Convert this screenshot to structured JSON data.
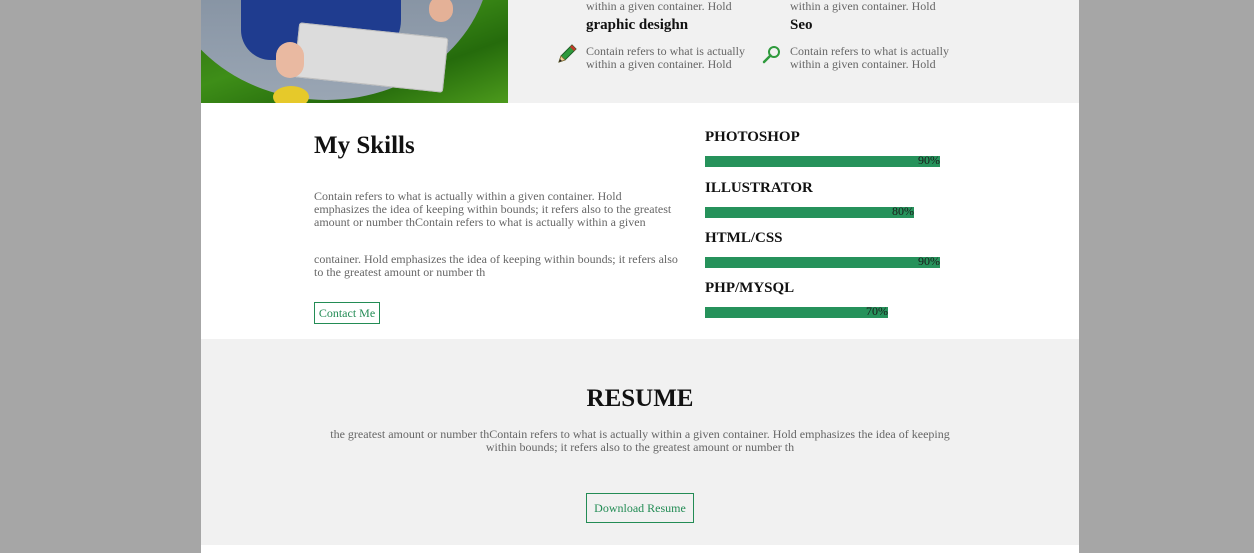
{
  "services": [
    {
      "top_text": "within a given container. Hold",
      "title": "graphic desighn",
      "icon": "pencil-icon",
      "text": "Contain refers to what is actually within a given container. Hold"
    },
    {
      "top_text": "within a given container. Hold",
      "title": "Seo",
      "icon": "magnifier-icon",
      "text": "Contain refers to what is actually within a given container. Hold"
    }
  ],
  "skills_section": {
    "title": "My Skills",
    "para1": "Contain refers to what is actually within a given container. Hold emphasizes the idea of keeping within bounds; it refers also to the greatest amount or number thContain refers to what is actually within a given",
    "para2": "container. Hold emphasizes the idea of keeping within bounds; it refers also to the greatest amount or number th",
    "contact_button": "Contact Me",
    "skills": [
      {
        "name": "PHOTOSHOP",
        "percent": 90,
        "label": "90%"
      },
      {
        "name": "ILLUSTRATOR",
        "percent": 80,
        "label": "80%"
      },
      {
        "name": "HTML/CSS",
        "percent": 90,
        "label": "90%"
      },
      {
        "name": "PHP/MYSQL",
        "percent": 70,
        "label": "70%"
      }
    ]
  },
  "resume": {
    "title": "RESUME",
    "text": "the greatest amount or number thContain refers to what is actually within a given container. Hold emphasizes the idea of keeping within bounds; it refers also to the greatest amount or number th",
    "download_button": "Download Resume"
  },
  "colors": {
    "accent": "#238c55",
    "bar": "#26925b",
    "band": "#f1f1f1",
    "outer": "#a6a6a6"
  }
}
